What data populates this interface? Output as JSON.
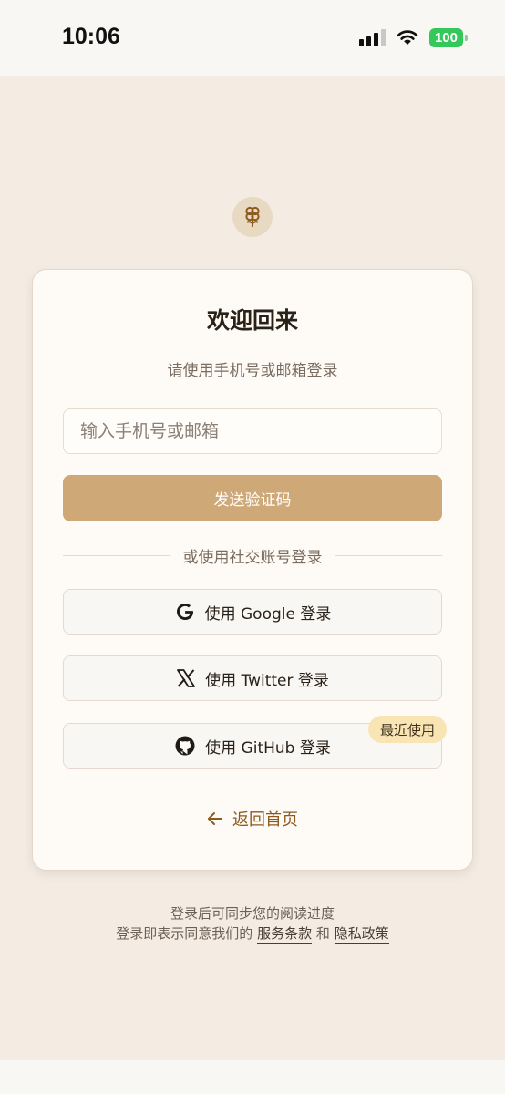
{
  "status_bar": {
    "time": "10:06",
    "battery": "100"
  },
  "card": {
    "title": "欢迎回来",
    "subtitle": "请使用手机号或邮箱登录",
    "contact_input": {
      "placeholder": "输入手机号或邮箱",
      "value": ""
    },
    "send_code_label": "发送验证码",
    "divider_label": "或使用社交账号登录",
    "social": [
      {
        "icon": "google-icon",
        "label": "使用 Google 登录"
      },
      {
        "icon": "x-icon",
        "label": "使用 Twitter 登录"
      },
      {
        "icon": "github-icon",
        "label": "使用 GitHub 登录"
      }
    ],
    "recent_badge": "最近使用",
    "back_label": "返回首页"
  },
  "footer": {
    "sync_note": "登录后可同步您的阅读进度",
    "agree_prefix": "登录即表示同意我们的",
    "terms": "服务条款",
    "and": "和",
    "privacy": "隐私政策"
  },
  "colors": {
    "background": "#f4ece3",
    "card": "#fefbf6",
    "primary_button": "#cfa878",
    "accent_link": "#8c5a1e",
    "badge": "#f9e4b4"
  }
}
